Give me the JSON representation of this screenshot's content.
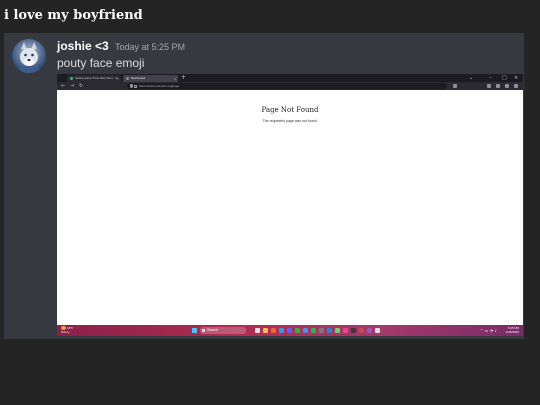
{
  "post": {
    "title": "i love my boyfriend"
  },
  "message": {
    "author": "joshie <3",
    "timestamp": "Today at 5:25 PM",
    "text": "pouty face emoji"
  },
  "embedded_screenshot": {
    "tabs": [
      {
        "label": "Series (Hour Time Mix) Sent · D"
      },
      {
        "label": "Not Found"
      }
    ],
    "new_tab_symbol": "+",
    "url": "https://www.example.org/page",
    "page_heading": "Page Not Found",
    "page_message": "The requested page was not found.",
    "taskbar": {
      "weather_temp": "18°F",
      "weather_desc": "Sunny",
      "search_placeholder": "Search",
      "tray_time": "5:25 PM",
      "tray_date": "1/26/2024"
    }
  },
  "colors": {
    "background": "#242424",
    "card": "#36393f",
    "author": "#ffffff",
    "timestamp": "#a3a6aa",
    "taskbar_accent": "#b02c53"
  }
}
